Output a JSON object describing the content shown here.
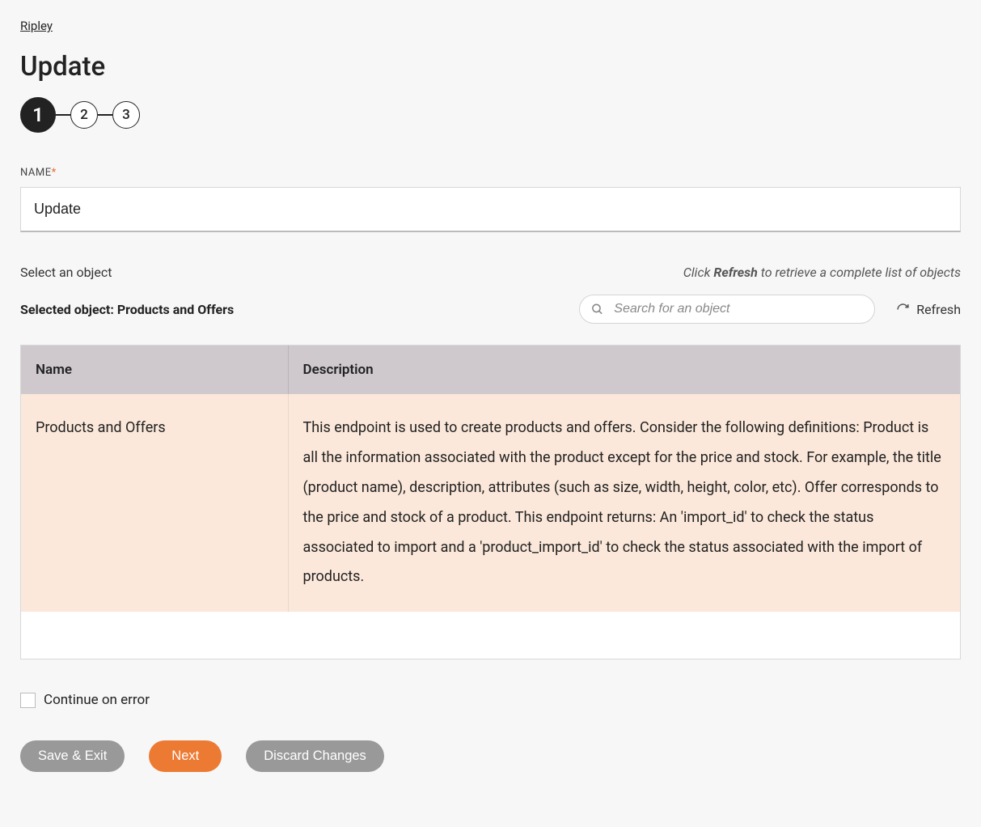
{
  "breadcrumb": "Ripley",
  "title": "Update",
  "stepper": {
    "steps": [
      "1",
      "2",
      "3"
    ],
    "active": 0
  },
  "nameField": {
    "label": "NAME",
    "required": "*",
    "value": "Update"
  },
  "objectSection": {
    "label": "Select an object",
    "hint_pre": "Click ",
    "hint_bold": "Refresh",
    "hint_post": " to retrieve a complete list of objects",
    "selected_prefix": "Selected object: ",
    "selected_value": "Products and Offers",
    "search_placeholder": "Search for an object",
    "refresh_label": "Refresh"
  },
  "table": {
    "headers": {
      "name": "Name",
      "description": "Description"
    },
    "rows": [
      {
        "name": "Products and Offers",
        "description": "This endpoint is used to create products and offers. Consider the following definitions: Product is all the information associated with the product except for the price and stock. For example, the title (product name), description, attributes (such as size, width, height, color, etc). Offer corresponds to the price and stock of a product. This endpoint returns: An 'import_id' to check the status associated to import and a 'product_import_id' to check the status associated with the import of products."
      }
    ]
  },
  "continueOnError": "Continue on error",
  "buttons": {
    "save": "Save & Exit",
    "next": "Next",
    "discard": "Discard Changes"
  }
}
